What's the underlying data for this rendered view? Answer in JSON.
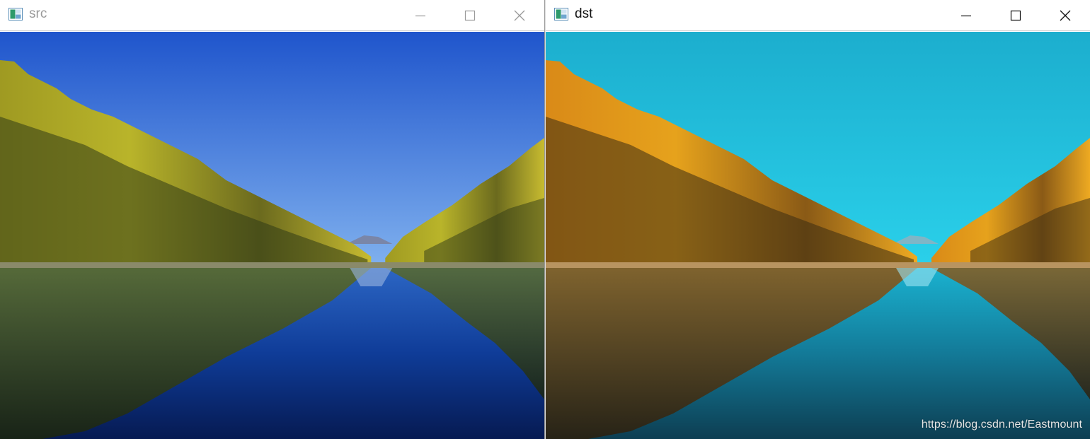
{
  "windows": [
    {
      "id": "src",
      "title": "src",
      "active": false,
      "image": {
        "subject": "lake with autumn forest reflection",
        "colors": {
          "sky_top": "#1f55cc",
          "sky_bottom": "#7fb0ee",
          "foliage_light": "#b9b42a",
          "foliage_dark": "#2f3a16",
          "water_top": "#2c66c4",
          "water_bottom": "#061a52"
        }
      }
    },
    {
      "id": "dst",
      "title": "dst",
      "active": true,
      "image": {
        "subject": "lake with autumn forest reflection (processed)",
        "colors": {
          "sky_top": "#1caece",
          "sky_bottom": "#2ad0ea",
          "foliage_light": "#e6a21c",
          "foliage_dark": "#3a2c12",
          "water_top": "#1ab2d0",
          "water_bottom": "#0d3e52"
        }
      }
    }
  ],
  "controls": {
    "minimize_icon": "minimize-icon",
    "maximize_icon": "maximize-icon",
    "close_icon": "close-icon"
  },
  "watermark": "https://blog.csdn.net/Eastmount"
}
